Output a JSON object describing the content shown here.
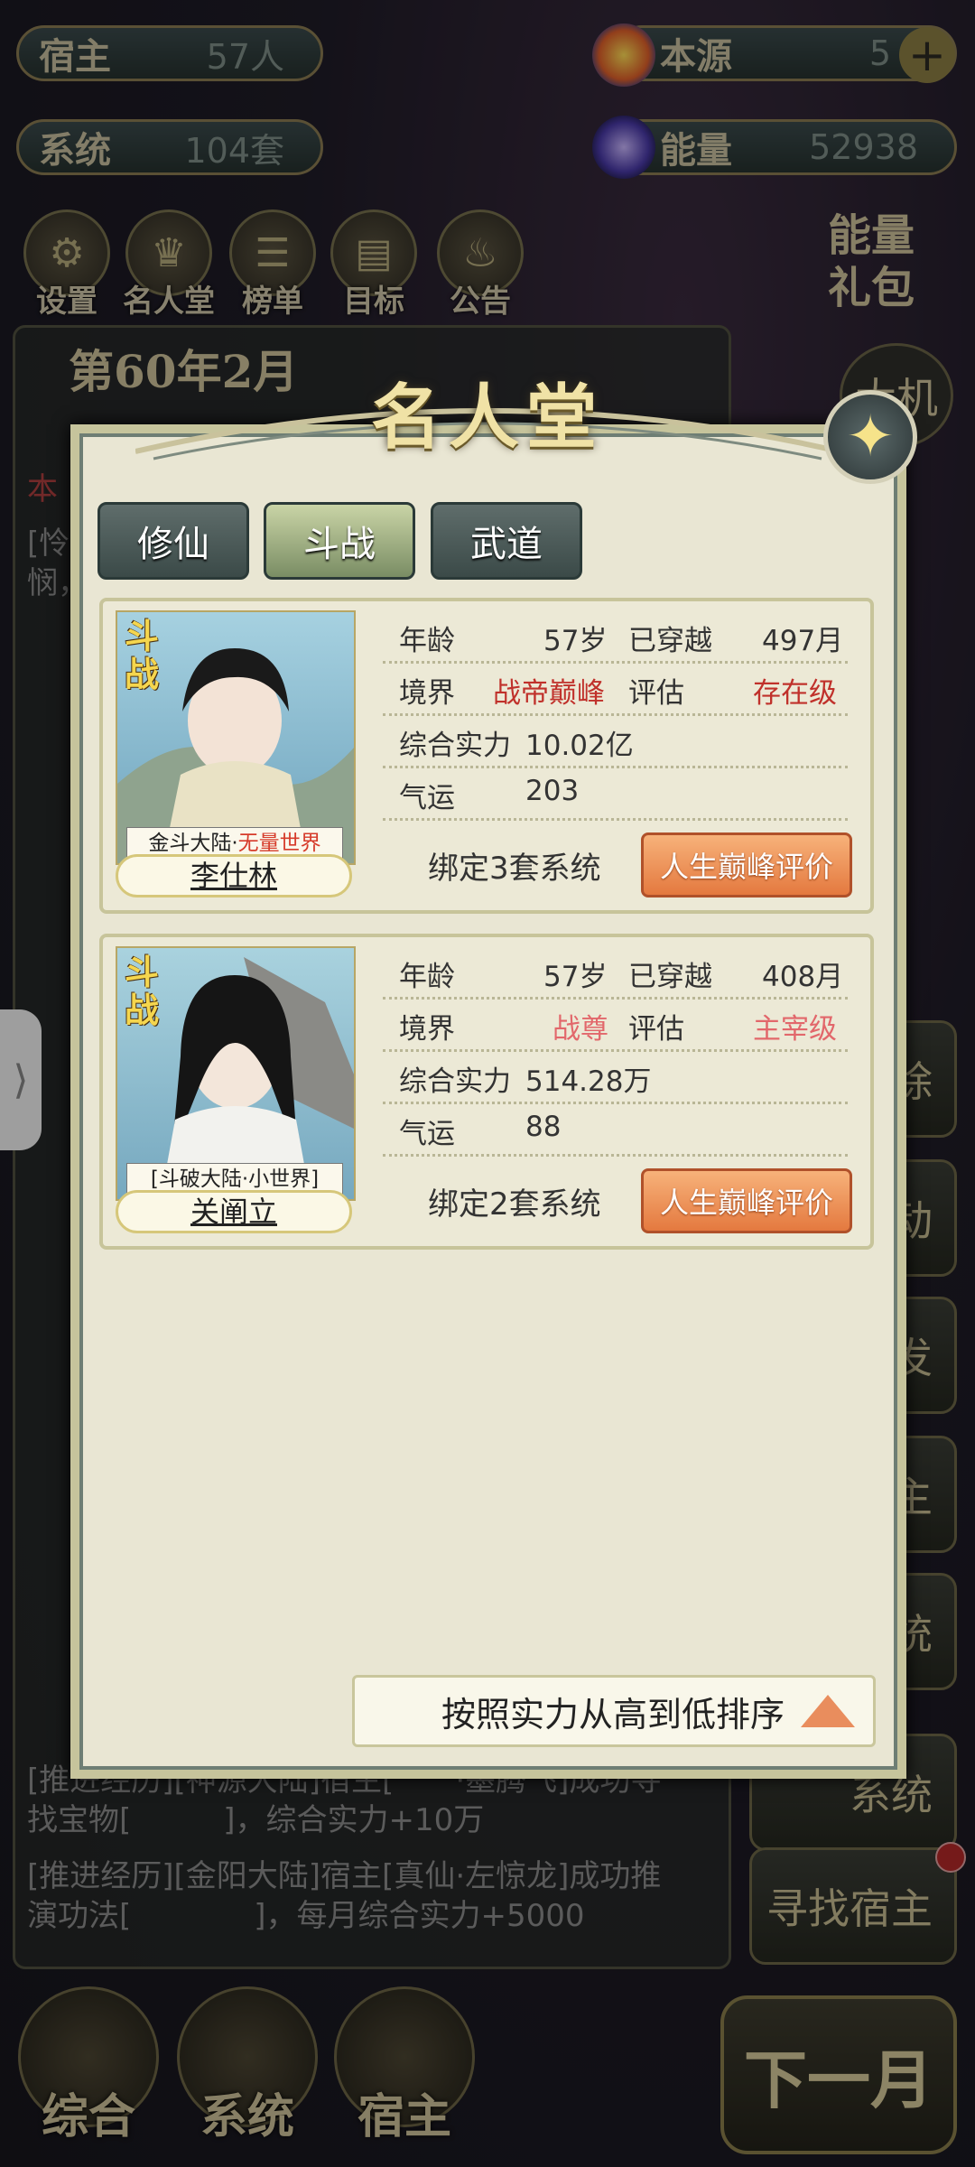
{
  "top": {
    "host": {
      "label": "宿主",
      "value": "57人"
    },
    "system": {
      "label": "系统",
      "value": "104套"
    },
    "origin": {
      "label": "本源",
      "value": "5"
    },
    "energy": {
      "label": "能量",
      "value": "52938"
    },
    "energy_gift": "能量礼包",
    "big_chance": "大机",
    "date": "第60年2月"
  },
  "top_icons": [
    "设置",
    "名人堂",
    "榜单",
    "目标",
    "公告"
  ],
  "background_log": [
    "本",
    "[怜",
    "悯，",
    "[推进经历][神源大陆]宿主[　　·墨腾飞]成功寻",
    "找宝物[　　　]，综合实力+10万",
    "[推进经历][金阳大陆]宿主[真仙·左惊龙]成功推",
    "演功法[　　　　]，每月综合实力+5000"
  ],
  "right_buttons": [
    "除",
    "动",
    "发",
    "主",
    "统",
    "系统",
    "寻找宿主"
  ],
  "bottom_nav": [
    "综合",
    "系统",
    "宿主",
    "下一月"
  ],
  "modal": {
    "title": "名人堂",
    "tabs": [
      {
        "label": "修仙",
        "active": false
      },
      {
        "label": "斗战",
        "active": true
      },
      {
        "label": "武道",
        "active": false
      }
    ],
    "cards": [
      {
        "tag": "斗战",
        "world_prefix": "金斗大陆·",
        "world_highlight": "无量世界",
        "name": "李仕林",
        "age_label": "年龄",
        "age": "57岁",
        "travel_label": "已穿越",
        "travel": "497月",
        "realm_label": "境界",
        "realm": "战帝巅峰",
        "eval_label": "评估",
        "eval": "存在级",
        "power_label": "综合实力",
        "power": "10.02亿",
        "luck_label": "气运",
        "luck": "203",
        "bind": "绑定3套系统",
        "button": "人生巅峰评价"
      },
      {
        "tag": "斗战",
        "world_prefix": "[斗破大陆·小世界]",
        "world_highlight": "",
        "name": "关阐立",
        "age_label": "年龄",
        "age": "57岁",
        "travel_label": "已穿越",
        "travel": "408月",
        "realm_label": "境界",
        "realm": "战尊",
        "eval_label": "评估",
        "eval": "主宰级",
        "power_label": "综合实力",
        "power": "514.28万",
        "luck_label": "气运",
        "luck": "88",
        "bind": "绑定2套系统",
        "button": "人生巅峰评价"
      }
    ],
    "sort_label": "按照实力从高到低排序"
  }
}
